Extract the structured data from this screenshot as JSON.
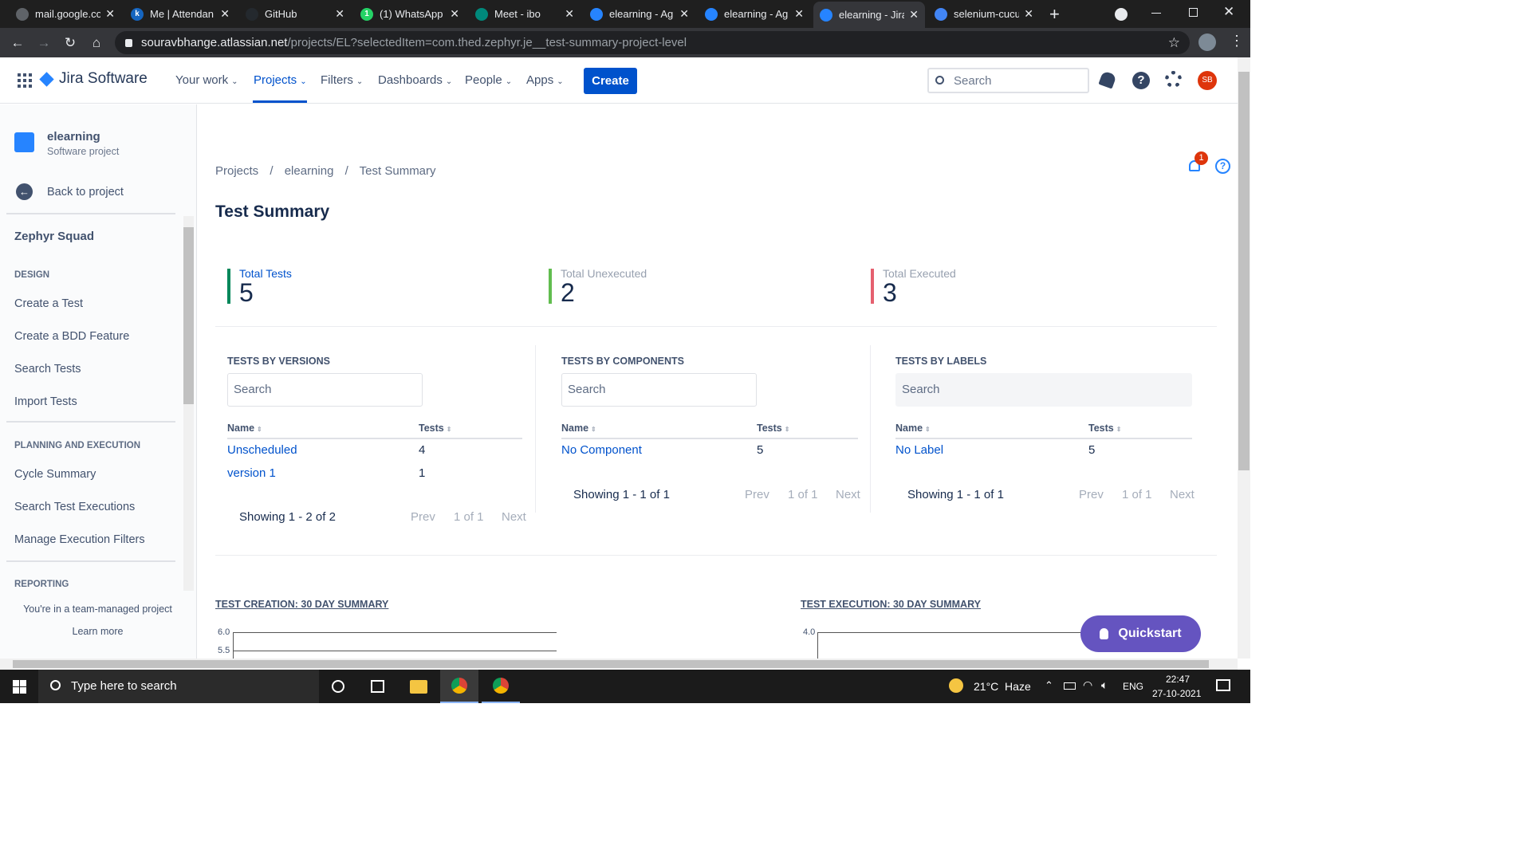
{
  "browser": {
    "tabs": [
      {
        "title": "mail.google.co",
        "fav_color": "#5f6368",
        "fav_letter": ""
      },
      {
        "title": "Me | Attendan",
        "fav_color": "#1565c0",
        "fav_letter": "k"
      },
      {
        "title": "GitHub",
        "fav_color": "#24292e",
        "fav_letter": ""
      },
      {
        "title": "(1) WhatsApp",
        "fav_color": "#25d366",
        "fav_letter": "1"
      },
      {
        "title": "Meet - ibo",
        "fav_color": "#00897b",
        "fav_letter": ""
      },
      {
        "title": "elearning - Ag",
        "fav_color": "#2684ff",
        "fav_letter": ""
      },
      {
        "title": "elearning - Ag",
        "fav_color": "#2684ff",
        "fav_letter": ""
      },
      {
        "title": "elearning - Jira",
        "fav_color": "#2684ff",
        "fav_letter": ""
      },
      {
        "title": "selenium-cucu",
        "fav_color": "#4285f4",
        "fav_letter": ""
      }
    ],
    "close_glyph": "✕",
    "new_tab": "+",
    "url_host": "souravbhange.atlassian.net",
    "url_path": "/projects/EL?selectedItem=com.thed.zephyr.je__test-summary-project-level"
  },
  "jira": {
    "logo_text": "Jira Software",
    "nav": [
      "Your work",
      "Projects",
      "Filters",
      "Dashboards",
      "People",
      "Apps"
    ],
    "create_label": "Create",
    "search_placeholder": "Search",
    "avatar_initials": "SB",
    "accent": "#0052cc"
  },
  "sidebar": {
    "project_name": "elearning",
    "project_type": "Software project",
    "back_label": "Back to project",
    "section_title": "Zephyr Squad",
    "design_head": "DESIGN",
    "design_items": [
      "Create a Test",
      "Create a BDD Feature",
      "Search Tests",
      "Import Tests"
    ],
    "planning_head": "PLANNING AND EXECUTION",
    "planning_items": [
      "Cycle Summary",
      "Search Test Executions",
      "Manage Execution Filters"
    ],
    "reporting_head": "REPORTING",
    "footer_text": "You're in a team-managed project",
    "learn_more": "Learn more"
  },
  "main": {
    "breadcrumb": [
      "Projects",
      "elearning",
      "Test Summary"
    ],
    "breadcrumb_sep": "/",
    "title": "Test Summary",
    "notification_count": "1",
    "stats": [
      {
        "label": "Total Tests",
        "value": "5",
        "color": "#00875a",
        "label_color": "#0052cc"
      },
      {
        "label": "Total Unexecuted",
        "value": "2",
        "color": "#61bd4f",
        "label_color": "#97a0af"
      },
      {
        "label": "Total Executed",
        "value": "3",
        "color": "#e5606f",
        "label_color": "#97a0af"
      }
    ],
    "panels": [
      {
        "title": "TESTS BY VERSIONS",
        "search": "Search",
        "col_name": "Name",
        "col_tests": "Tests",
        "rows": [
          {
            "name": "Unscheduled",
            "tests": "4"
          },
          {
            "name": "version 1",
            "tests": "1"
          }
        ],
        "showing": "Showing 1 - 2 of 2",
        "prev": "Prev",
        "page": "1 of 1",
        "next": "Next"
      },
      {
        "title": "TESTS BY COMPONENTS",
        "search": "Search",
        "col_name": "Name",
        "col_tests": "Tests",
        "rows": [
          {
            "name": "No Component",
            "tests": "5"
          }
        ],
        "showing": "Showing 1 - 1 of 1",
        "prev": "Prev",
        "page": "1 of 1",
        "next": "Next"
      },
      {
        "title": "TESTS BY LABELS",
        "search": "Search",
        "col_name": "Name",
        "col_tests": "Tests",
        "rows": [
          {
            "name": "No Label",
            "tests": "5"
          }
        ],
        "showing": "Showing 1 - 1 of 1",
        "prev": "Prev",
        "page": "1 of 1",
        "next": "Next"
      }
    ],
    "creation_title": "TEST CREATION: 30 DAY SUMMARY",
    "execution_title": "TEST EXECUTION: 30 DAY SUMMARY",
    "creation_ticks": [
      "6.0",
      "5.5"
    ],
    "execution_ticks": [
      "4.0"
    ],
    "quickstart_label": "Quickstart"
  },
  "taskbar": {
    "search_placeholder": "Type here to search",
    "weather": "21°C  Haze",
    "lang": "ENG",
    "time": "22:47",
    "date": "27-10-2021"
  }
}
